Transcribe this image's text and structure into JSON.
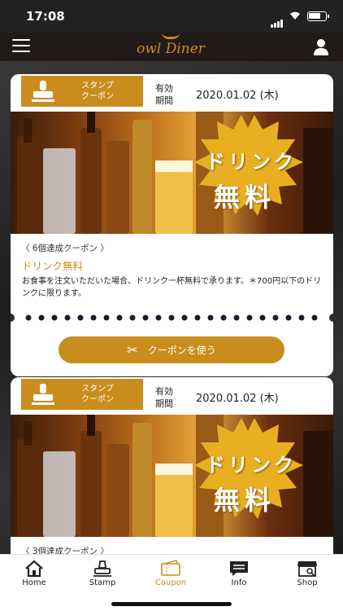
{
  "status": {
    "time": "17:08"
  },
  "header": {
    "logo": "owl Diner"
  },
  "coupons": [
    {
      "badge": [
        "スタンプ",
        "クーポン"
      ],
      "expiry_label": [
        "有効",
        "期間"
      ],
      "expiry_date": "2020.01.02 (木)",
      "promo": [
        "ドリンク",
        "無料"
      ],
      "condition": "〈 6個達成クーポン 〉",
      "title": "ドリンク無料",
      "description": "お食事を注文いただいた場合、ドリンク一杯無料で承ります。＊700円以下のドリンクに限ります。",
      "button": "クーポンを使う"
    },
    {
      "badge": [
        "スタンプ",
        "クーポン"
      ],
      "expiry_label": [
        "有効",
        "期間"
      ],
      "expiry_date": "2020.01.02 (木)",
      "promo": [
        "ドリンク",
        "無料"
      ],
      "condition": "〈 3個達成クーポン 〉"
    }
  ],
  "tabs": [
    {
      "label": "Home",
      "icon": "home-icon"
    },
    {
      "label": "Stamp",
      "icon": "stamp-icon"
    },
    {
      "label": "Coupon",
      "icon": "ticket-icon",
      "active": true
    },
    {
      "label": "Info",
      "icon": "chat-icon"
    },
    {
      "label": "Shop",
      "icon": "shop-icon"
    }
  ],
  "colors": {
    "accent": "#c98d1e",
    "header": "#221a18"
  }
}
